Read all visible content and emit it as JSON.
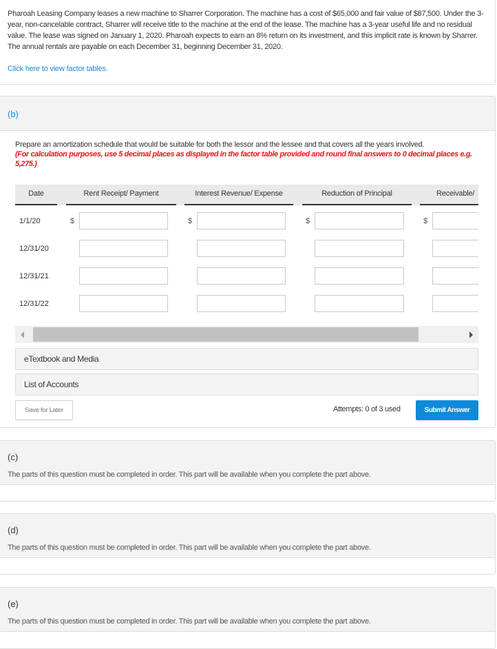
{
  "intro": {
    "text": "Pharoah Leasing Company leases a new machine to Sharrer Corporation. The machine has a cost of $65,000 and fair value of $87,500. Under the 3-year, non-cancelable contract, Sharrer will receive title to the machine at the end of the lease. The machine has a 3-year useful life and no residual value. The lease was signed on January 1, 2020. Pharoah expects to earn an 8% return on its investment, and this implicit rate is known by Sharrer. The annual rentals are payable on each December 31, beginning December 31, 2020.",
    "factor_link": "Click here to view factor tables."
  },
  "part_b": {
    "label": "(b)",
    "instruction": "Prepare an amortization schedule that would be suitable for both the lessor and the lessee and that covers all the years involved.",
    "note": "(For calculation purposes, use 5 decimal places as displayed in the factor table provided and round final answers to 0 decimal places e.g. 5,275.)",
    "table": {
      "headers": [
        "Date",
        "Rent Receipt/ Payment",
        "Interest Revenue/ Expense",
        "Reduction of Principal",
        "Receivable/"
      ],
      "currency_symbol": "$",
      "rows": [
        {
          "date": "1/1/20",
          "values": [
            "",
            "",
            "",
            ""
          ]
        },
        {
          "date": "12/31/20",
          "values": [
            "",
            "",
            "",
            ""
          ]
        },
        {
          "date": "12/31/21",
          "values": [
            "",
            "",
            "",
            ""
          ]
        },
        {
          "date": "12/31/22",
          "values": [
            "",
            "",
            "",
            ""
          ]
        }
      ]
    },
    "etextbook_label": "eTextbook and Media",
    "accounts_label": "List of Accounts",
    "save_label": "Save for Later",
    "attempts": "Attempts: 0 of 3 used",
    "submit_label": "Submit Answer"
  },
  "locked_parts": [
    {
      "label": "(c)",
      "message": "The parts of this question must be completed in order. This part will be available when you complete the part above."
    },
    {
      "label": "(d)",
      "message": "The parts of this question must be completed in order. This part will be available when you complete the part above."
    },
    {
      "label": "(e)",
      "message": "The parts of this question must be completed in order. This part will be available when you complete the part above."
    }
  ],
  "colors": {
    "link": "#1a8ad1",
    "note": "#e8141b",
    "primary_button": "#0e8ad9"
  }
}
